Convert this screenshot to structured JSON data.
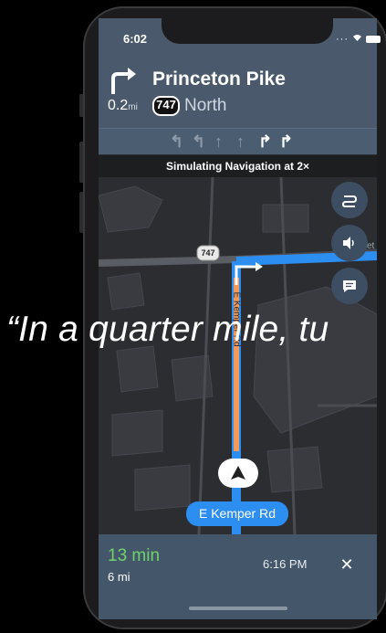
{
  "status_bar": {
    "time": "6:02",
    "signal_icon": "dots-signal-icon",
    "wifi_icon": "wifi-icon",
    "battery_icon": "battery-icon"
  },
  "instruction": {
    "icon": "turn-right-arrow-icon",
    "distance": "0.2",
    "distance_unit": "mi",
    "street": "Princeton Pike",
    "route_number": "747",
    "direction": "North"
  },
  "lanes": [
    {
      "icon": "turn-left-icon",
      "active": false
    },
    {
      "icon": "turn-left-icon",
      "active": false
    },
    {
      "icon": "straight-icon",
      "active": false
    },
    {
      "icon": "straight-icon",
      "active": false
    },
    {
      "icon": "turn-right-icon",
      "active": true
    },
    {
      "icon": "turn-right-icon",
      "active": true
    }
  ],
  "simulation_banner": "Simulating Navigation at 2×",
  "map": {
    "route_shield_label": "747",
    "street_label": "E Kemper Rd",
    "current_road": "E Kemper Rd",
    "partial_label": "et"
  },
  "voice_caption": "“In a quarter mile, tu",
  "map_buttons": [
    {
      "name": "overview-button",
      "icon": "route-overview-icon"
    },
    {
      "name": "mute-button",
      "icon": "speaker-icon"
    },
    {
      "name": "feedback-button",
      "icon": "feedback-icon"
    }
  ],
  "trip": {
    "duration": "13 min",
    "distance": "6 mi",
    "arrival_time": "6:16 PM",
    "close_label": "✕"
  },
  "colors": {
    "banner": "#4a5a6c",
    "route_blue": "#2d8ef2",
    "traffic_orange": "#f19a5a",
    "eta_green": "#6fd36b",
    "map_bg": "#2b2d31"
  }
}
